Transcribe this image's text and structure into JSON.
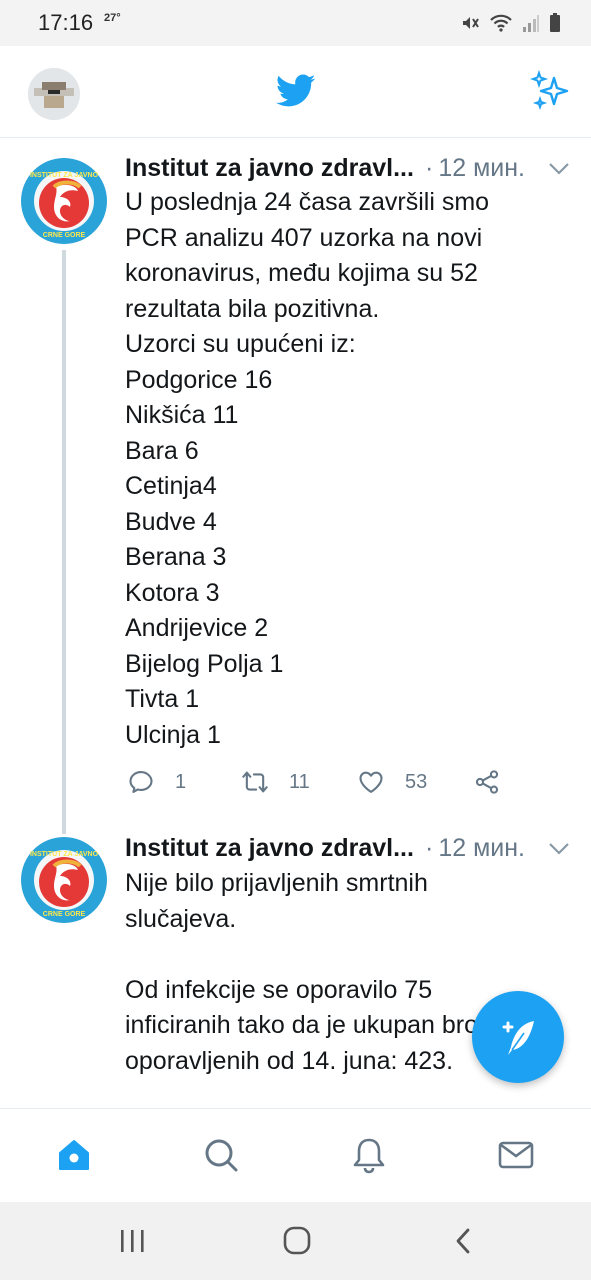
{
  "status_bar": {
    "time": "17:16",
    "temperature": "27°",
    "icons": [
      "mute-icon",
      "wifi-icon",
      "signal-icon",
      "battery-icon"
    ]
  },
  "header": {
    "avatar": "user-avatar",
    "logo": "twitter-bird-icon",
    "action": "sparkle-icon"
  },
  "tweets": [
    {
      "author": "Institut za javno zdravl...",
      "separator": "·",
      "time": "12 мин.",
      "lines": [
        "U poslednja 24 časa završili smo",
        "PCR analizu 407 uzorka na novi",
        "koronavirus, među kojima su 52",
        "rezultata bila pozitivna.",
        "Uzorci su upućeni iz:",
        "Podgorice 16",
        "Nikšića 11",
        "Bara 6",
        "Cetinja4",
        "Budve 4",
        "Berana 3",
        "Kotora 3",
        "Andrijevice 2",
        "Bijelog Polja 1",
        "Tivta 1",
        "Ulcinja 1"
      ],
      "replies": "1",
      "retweets": "11",
      "likes": "53"
    },
    {
      "author": "Institut za javno zdravl...",
      "separator": "·",
      "time": "12 мин.",
      "lines": [
        "Nije bilo prijavljenih smrtnih",
        "slučajeva.",
        "",
        "Od infekcije se oporavilo 75",
        "inficiranih tako da je ukupan broj",
        "oporavljenih od 14. juna: 423."
      ]
    }
  ],
  "colors": {
    "accent": "#1da1f2",
    "text": "#14171a",
    "muted": "#657786"
  },
  "bottom_nav": [
    "home-icon",
    "search-icon",
    "notifications-icon",
    "messages-icon"
  ],
  "system_nav": [
    "recent-apps-icon",
    "home-button-icon",
    "back-icon"
  ]
}
